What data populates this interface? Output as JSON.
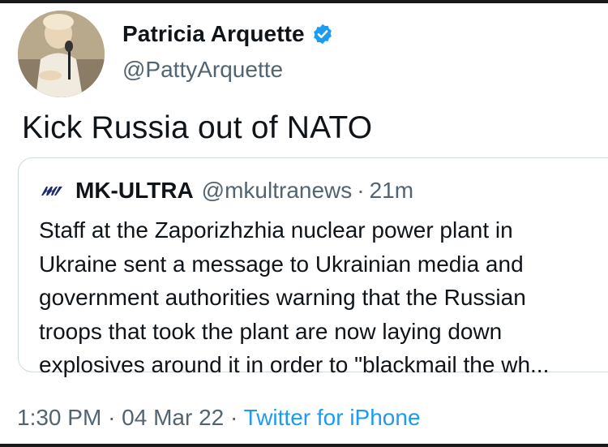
{
  "author": {
    "name": "Patricia Arquette",
    "handle": "@PattyArquette",
    "verified": true,
    "avatar_icon": "profile-photo"
  },
  "tweet": {
    "text": "Kick Russia out of NATO"
  },
  "quoted_tweet": {
    "name": "MK-ULTRA",
    "handle": "@mkultranews",
    "separator": "·",
    "time": "21m",
    "logo_icon": "mk-logo",
    "lines": [
      "Staff at the Zaporizhzhia nuclear power plant in",
      "Ukraine sent a message to Ukrainian media and",
      "government authorities warning that the Russian",
      "troops that took the plant are now laying down",
      "explosives around it in order to \"blackmail the wh..."
    ]
  },
  "meta": {
    "time": "1:30 PM",
    "sep1": "·",
    "date": "04 Mar 22",
    "sep2": "·",
    "source": "Twitter for iPhone"
  },
  "colors": {
    "text": "#0f1419",
    "secondary": "#536471",
    "accent": "#1d9bf0",
    "border": "#cfd9de"
  }
}
